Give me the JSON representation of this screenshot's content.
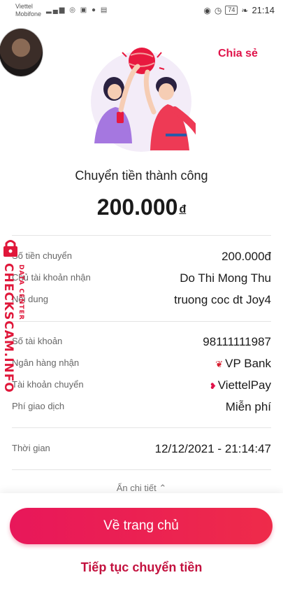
{
  "status_bar": {
    "carrier_line1": "Viettel",
    "carrier_line2": "Mobifone",
    "battery": "74",
    "time": "21:14"
  },
  "header": {
    "share_label": "Chia sẻ"
  },
  "result": {
    "title": "Chuyển tiền thành công",
    "amount": "200.000",
    "currency": "đ"
  },
  "details": [
    {
      "label": "Số tiền chuyển",
      "value": "200.000đ"
    },
    {
      "label": "Chủ tài khoản nhận",
      "value": "Do Thi Mong Thu"
    },
    {
      "label": "Nội dung",
      "value": "truong coc dt Joy4"
    },
    {
      "label": "Số tài khoản",
      "value": "98111111987"
    },
    {
      "label": "Ngân hàng nhận",
      "value": "VP Bank"
    },
    {
      "label": "Tài khoản chuyển",
      "value": "ViettelPay"
    },
    {
      "label": "Phí giao dịch",
      "value": "Miễn phí"
    },
    {
      "label": "Thời gian",
      "value": "12/12/2021 - 21:14:47"
    }
  ],
  "hide_details_label": "Ẩn chi tiết",
  "actions": {
    "home_label": "Về trang chủ",
    "continue_label": "Tiếp tục chuyển tiền"
  },
  "watermark": {
    "site": "CHECKSCAM.INFO",
    "sub": "DATA CENTER"
  },
  "colors": {
    "accent": "#e0134a",
    "button_gradient_start": "#e8175a",
    "button_gradient_end": "#ee2b4a"
  }
}
